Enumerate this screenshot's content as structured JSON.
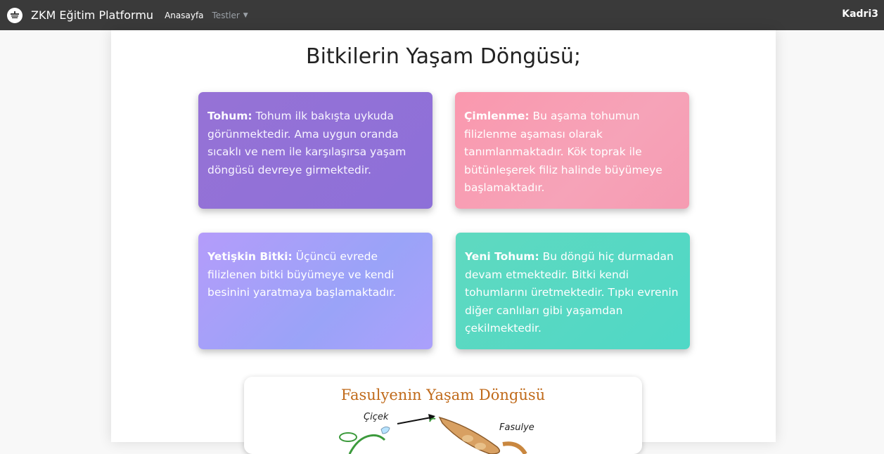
{
  "navbar": {
    "brand": "ZKM Eğitim Platformu",
    "links": [
      {
        "label": "Anasayfa"
      },
      {
        "label": "Testler"
      }
    ],
    "user": "Kadri3"
  },
  "main": {
    "title": "Bitkilerin Yaşam Döngüsü;",
    "cards": [
      {
        "heading": "Tohum:",
        "text": " Tohum ilk bakışta uykuda görünmektedir. Ama uygun oranda sıcaklı ve nem ile karşılaşırsa yaşam döngüsü devreye girmektedir."
      },
      {
        "heading": "Çimlenme:",
        "text": " Bu aşama tohumun filizlenme aşaması olarak tanımlanmaktadır. Kök toprak ile bütünleşerek filiz halinde büyümeye başlamaktadır."
      },
      {
        "heading": "Yetişkin Bitki:",
        "text": " Üçüncü evrede filizlenen bitki büyümeye ve kendi besinini yaratmaya başlamaktadır."
      },
      {
        "heading": "Yeni Tohum:",
        "text": " Bu döngü hiç durmadan devam etmektedir. Bitki kendi tohumlarını üretmektedir. Tıpkı evrenin diğer canlıları gibi yaşamdan çekilmektedir."
      }
    ],
    "diagram": {
      "title": "Fasulyenin Yaşam Döngüsü",
      "labels": [
        "Çiçek",
        "Fasulye"
      ]
    }
  },
  "colors": {
    "navbar": "#3a3a3a",
    "card_tohum": "#9672d6",
    "card_cimlenme": "#fa98ae",
    "card_yetiskin": "#b49cfa",
    "card_yenitohum": "#5fd9c0"
  }
}
